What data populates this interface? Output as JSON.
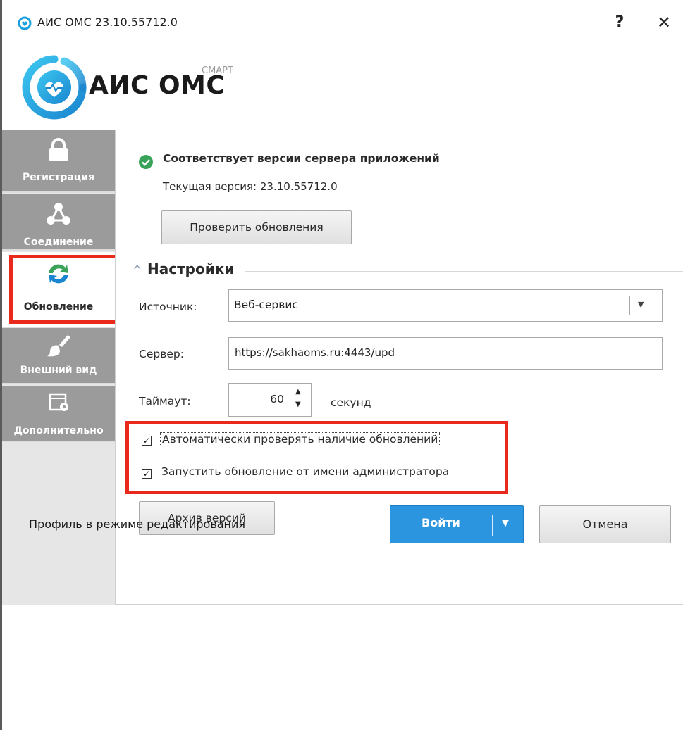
{
  "window": {
    "title": "АИС ОМС 23.10.55712.0",
    "help_label": "?",
    "close_label": "✕"
  },
  "logo": {
    "name": "АИС ОМС",
    "sup": "СМАРТ"
  },
  "sidebar": {
    "items": [
      {
        "label": "Регистрация",
        "icon": "lock-icon"
      },
      {
        "label": "Соединение",
        "icon": "network-icon"
      },
      {
        "label": "Обновление",
        "icon": "update-icon",
        "active": true
      },
      {
        "label": "Внешний вид",
        "icon": "brush-icon"
      },
      {
        "label": "Дополнительно",
        "icon": "window-settings-icon"
      }
    ]
  },
  "status": {
    "title": "Соответствует версии сервера приложений",
    "version": "Текущая версия: 23.10.55712.0",
    "check_button": "Проверить обновления"
  },
  "settings": {
    "section_title": "Настройки",
    "source_label": "Источник:",
    "source_value": "Веб-сервис",
    "server_label": "Сервер:",
    "server_value": "https://sakhaoms.ru:4443/upd",
    "timeout_label": "Таймаут:",
    "timeout_value": "60",
    "timeout_unit": "секунд",
    "auto_check_label": "Автоматически проверять наличие обновлений",
    "auto_check_checked": true,
    "run_as_admin_label": "Запустить обновление от имени администратора",
    "run_as_admin_checked": true,
    "archive_button": "Архив версий"
  },
  "footer": {
    "status_text": "Профиль в режиме редактирования",
    "login_button": "Войти",
    "cancel_button": "Отмена"
  },
  "colors": {
    "accent": "#2b95e0",
    "highlight": "#e8291b",
    "sidebar_item": "#9b9b9b",
    "ok_green": "#3aa35a"
  }
}
